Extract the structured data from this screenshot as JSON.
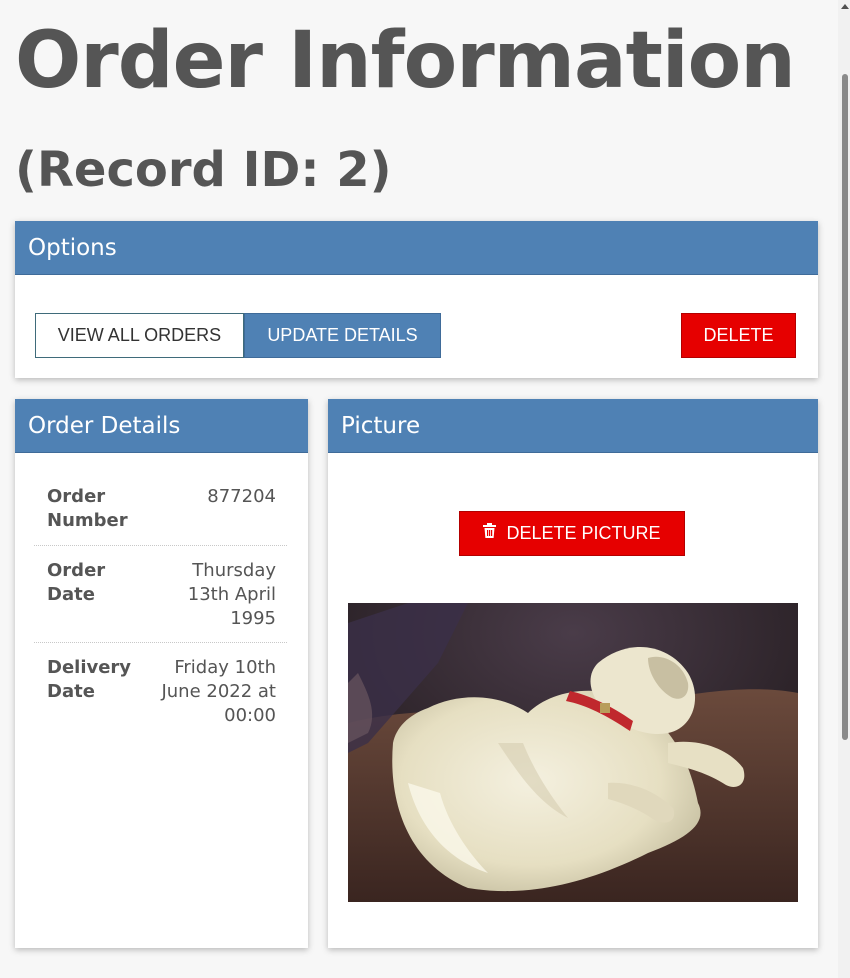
{
  "page": {
    "title": "Order Information",
    "subtitle": "(Record ID: 2)"
  },
  "options_panel": {
    "header": "Options",
    "view_all_label": "VIEW ALL ORDERS",
    "update_label": "UPDATE DETAILS",
    "delete_label": "DELETE"
  },
  "order_details_panel": {
    "header": "Order Details",
    "rows": [
      {
        "label": "Order Number",
        "value": "877204"
      },
      {
        "label": "Order Date",
        "value": "Thursday 13th April 1995"
      },
      {
        "label": "Delivery Date",
        "value": "Friday 10th June 2022 at 00:00"
      }
    ]
  },
  "picture_panel": {
    "header": "Picture",
    "delete_picture_label": "DELETE PICTURE",
    "icon": "trash-icon"
  },
  "colors": {
    "header_blue": "#4f81b4",
    "danger_red": "#e60000",
    "text_grey": "#555555"
  }
}
